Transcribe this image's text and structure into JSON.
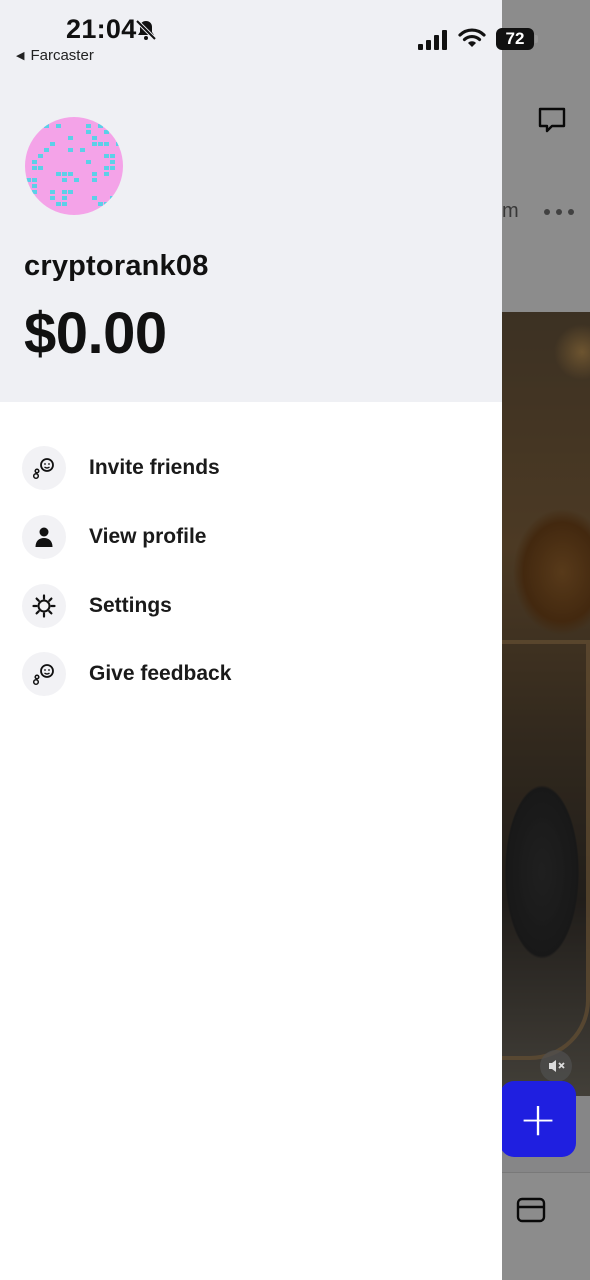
{
  "status_bar": {
    "time": "21:04",
    "back_label": "Farcaster",
    "battery": "72",
    "icons": [
      "bell-slash-icon",
      "signal-icon",
      "wifi-icon",
      "battery-icon"
    ]
  },
  "drawer": {
    "avatar_icon": "pixel-avatar",
    "username": "cryptorank08",
    "balance": "$0.00",
    "menu": [
      {
        "label": "Invite friends",
        "icon": "invite-friends-icon"
      },
      {
        "label": "View profile",
        "icon": "person-icon"
      },
      {
        "label": "Settings",
        "icon": "gear-icon"
      },
      {
        "label": "Give feedback",
        "icon": "feedback-icon"
      }
    ]
  },
  "background": {
    "header_fragment": "m",
    "fab_label": "+",
    "fab_color": "#1f1fe0"
  },
  "colors": {
    "drawer_header_bg": "#eff0f4",
    "avatar_bg": "#f4a3e8",
    "avatar_pixels": "#5bd0e8"
  }
}
